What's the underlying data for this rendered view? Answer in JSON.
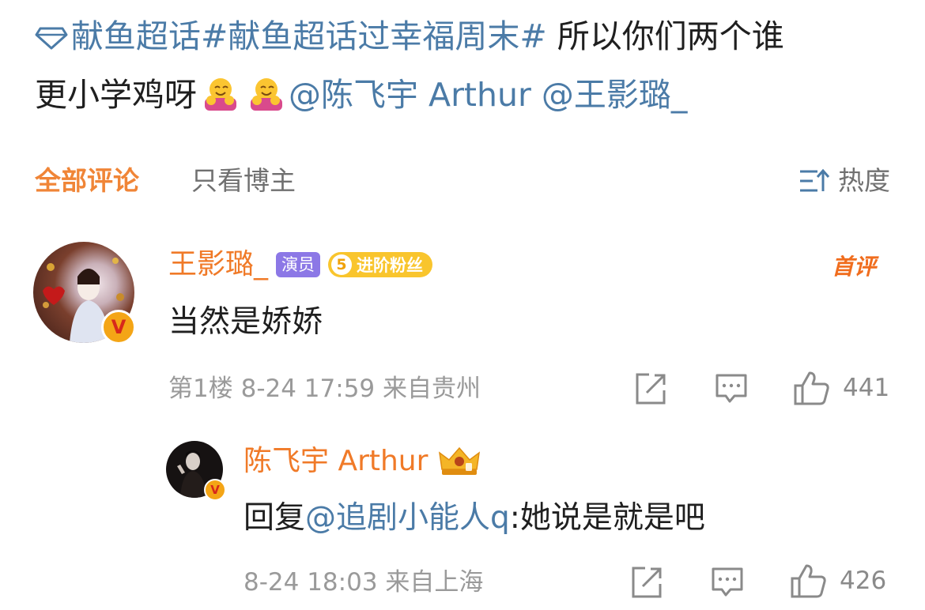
{
  "post": {
    "line1_link": "献鱼超话#献鱼超话过幸福周末#",
    "line1_text": " 所以你们两个谁",
    "line2_text": "更小学鸡呀",
    "mention1": "@陈飞宇 Arthur",
    "mention2": "@王影璐_"
  },
  "tabs": {
    "all_comments": "全部评论",
    "author_only": "只看博主",
    "sort_label": "热度"
  },
  "comments": [
    {
      "username": "王影璐_",
      "role_tag": "演员",
      "fan_level": "5",
      "fan_label": "进阶粉丝",
      "first_badge": "首评",
      "text": "当然是娇娇",
      "floor": "第1楼",
      "datetime": "8-24 17:59",
      "location": "来自贵州",
      "likes": "441"
    }
  ],
  "reply": {
    "username": "陈飞宇 Arthur",
    "reply_prefix": "回复",
    "reply_mention": "@追剧小能人q",
    "text": ":她说是就是吧",
    "datetime": "8-24 18:03",
    "location": "来自上海",
    "likes": "426"
  },
  "colors": {
    "link": "#4b7ba7",
    "username": "#f07a28",
    "active_tab": "#f08537",
    "meta": "#9a9a9a"
  },
  "icons": [
    "diamond-icon",
    "hug-emoji-icon",
    "sort-icon",
    "verified-v-icon",
    "crown-icon",
    "repost-icon",
    "comment-icon",
    "like-icon"
  ]
}
